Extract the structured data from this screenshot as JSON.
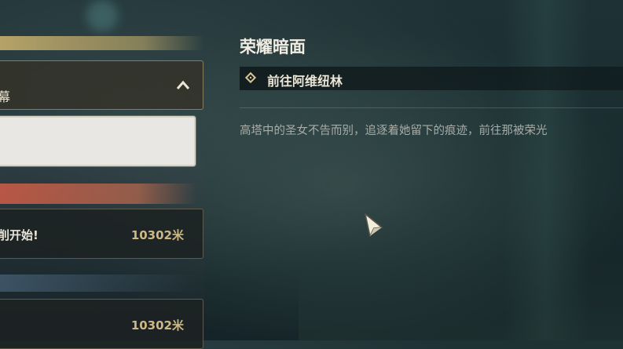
{
  "quest_list": {
    "chapter_title": "幕",
    "quests": [
      {
        "name": "削开始!",
        "distance": "10302米"
      },
      {
        "name": "",
        "distance": "10302米"
      }
    ]
  },
  "quest_detail": {
    "title": "荣耀暗面",
    "objective": "前往阿维纽林",
    "description": "高塔中的圣女不告而别，追逐着她留下的痕迹，前往那被荣光"
  },
  "icons": {
    "chevron": "chevron-up-icon",
    "objective_marker": "diamond-icon",
    "cursor": "cursor-icon"
  },
  "colors": {
    "gold_accent": "#cdb985",
    "red_accent": "#c85a46",
    "selected_bg": "#e8e7e3"
  }
}
